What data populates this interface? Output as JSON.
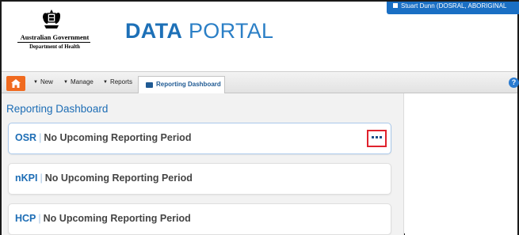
{
  "header": {
    "gov_title": "Australian Government",
    "gov_dept": "Department of Health",
    "portal_bold": "DATA",
    "portal_light": " PORTAL",
    "user_text": "Stuart Dunn (DOSRAL, ABORIGINAL"
  },
  "nav": {
    "items": [
      {
        "label": "New"
      },
      {
        "label": "Manage"
      },
      {
        "label": "Reports"
      }
    ],
    "active_tab": "Reporting Dashboard",
    "help_symbol": "?"
  },
  "main": {
    "title": "Reporting Dashboard",
    "cards": [
      {
        "code": "OSR",
        "separator": "|",
        "text": "No Upcoming Reporting Period",
        "has_menu": true
      },
      {
        "code": "nKPI",
        "separator": "|",
        "text": "No Upcoming Reporting Period",
        "has_menu": false
      },
      {
        "code": "HCP",
        "separator": "|",
        "text": "No Upcoming Reporting Period",
        "has_menu": false
      }
    ]
  },
  "colors": {
    "brand_blue": "#1d70b7",
    "home_orange": "#f06a1f",
    "highlight_red": "#e0222d"
  },
  "icons": [
    "coat-of-arms-icon",
    "user-icon",
    "home-icon",
    "caret-down-icon",
    "dashboard-icon",
    "help-icon",
    "more-options-icon"
  ]
}
